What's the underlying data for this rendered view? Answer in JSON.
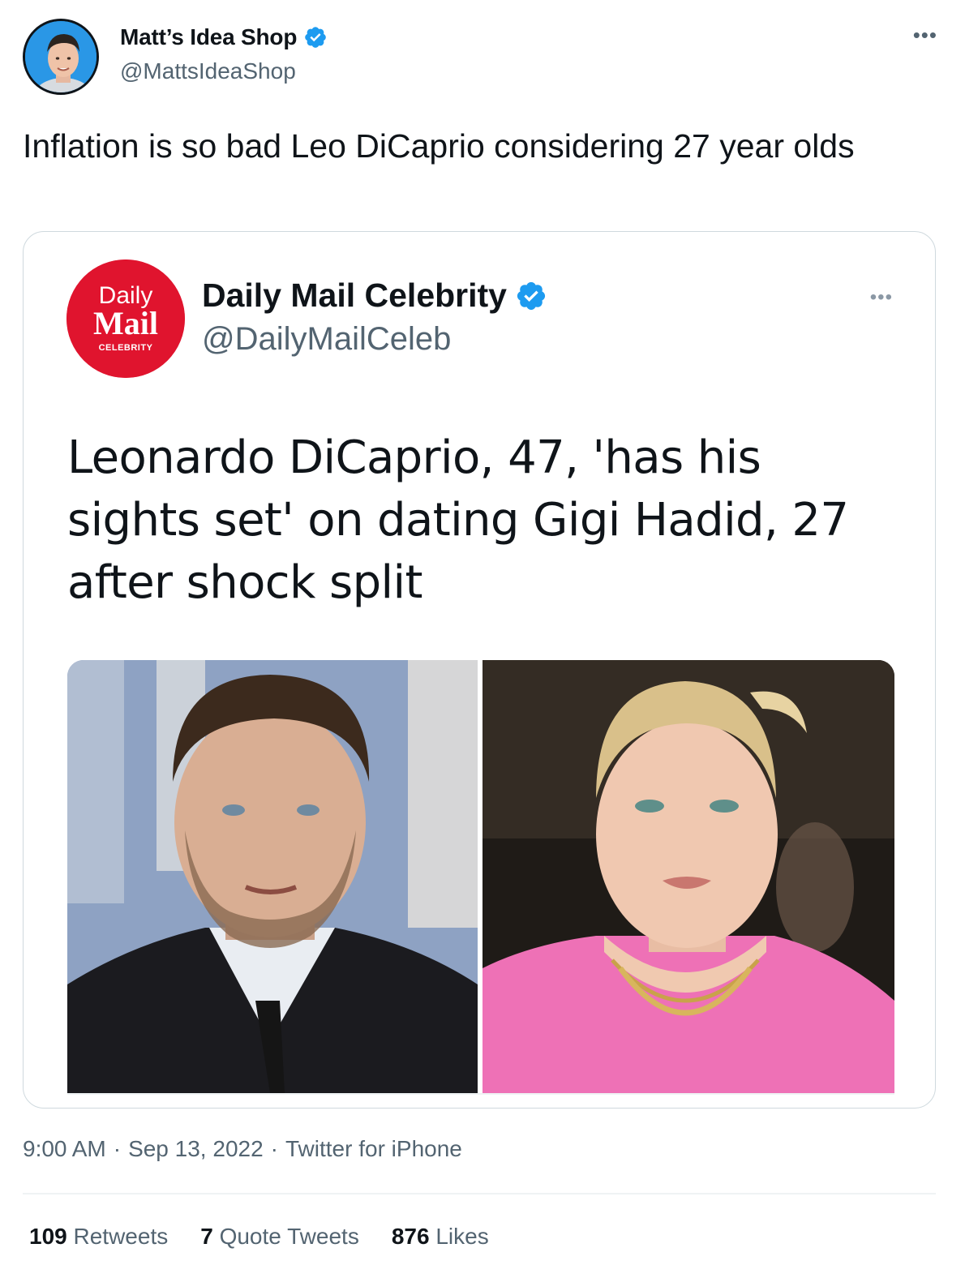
{
  "author": {
    "display_name": "Matt’s Idea Shop",
    "handle": "@MattsIdeaShop"
  },
  "tweet": {
    "text": "Inflation is so bad Leo DiCaprio considering 27 year olds"
  },
  "quoted": {
    "display_name": "Daily Mail Celebrity",
    "handle": "@DailyMailCeleb",
    "logo_line1": "Daily",
    "logo_line2": "Mail",
    "logo_line3": "CELEBRITY",
    "text": "Leonardo DiCaprio, 47, 'has his sights set' on dating Gigi Hadid, 27 after shock split"
  },
  "meta": {
    "time": "9:00 AM",
    "date": "Sep 13, 2022",
    "source": "Twitter for iPhone",
    "separator": "·"
  },
  "stats": {
    "retweets_count": "109",
    "retweets_label": "Retweets",
    "quotes_count": "7",
    "quotes_label": "Quote Tweets",
    "likes_count": "876",
    "likes_label": "Likes"
  },
  "colors": {
    "verified_blue": "#1d9bf0",
    "secondary_text": "#536471",
    "daily_mail_red": "#e0142e"
  },
  "icons": {
    "verified": "verified-badge-icon",
    "more": "more-options-icon"
  }
}
